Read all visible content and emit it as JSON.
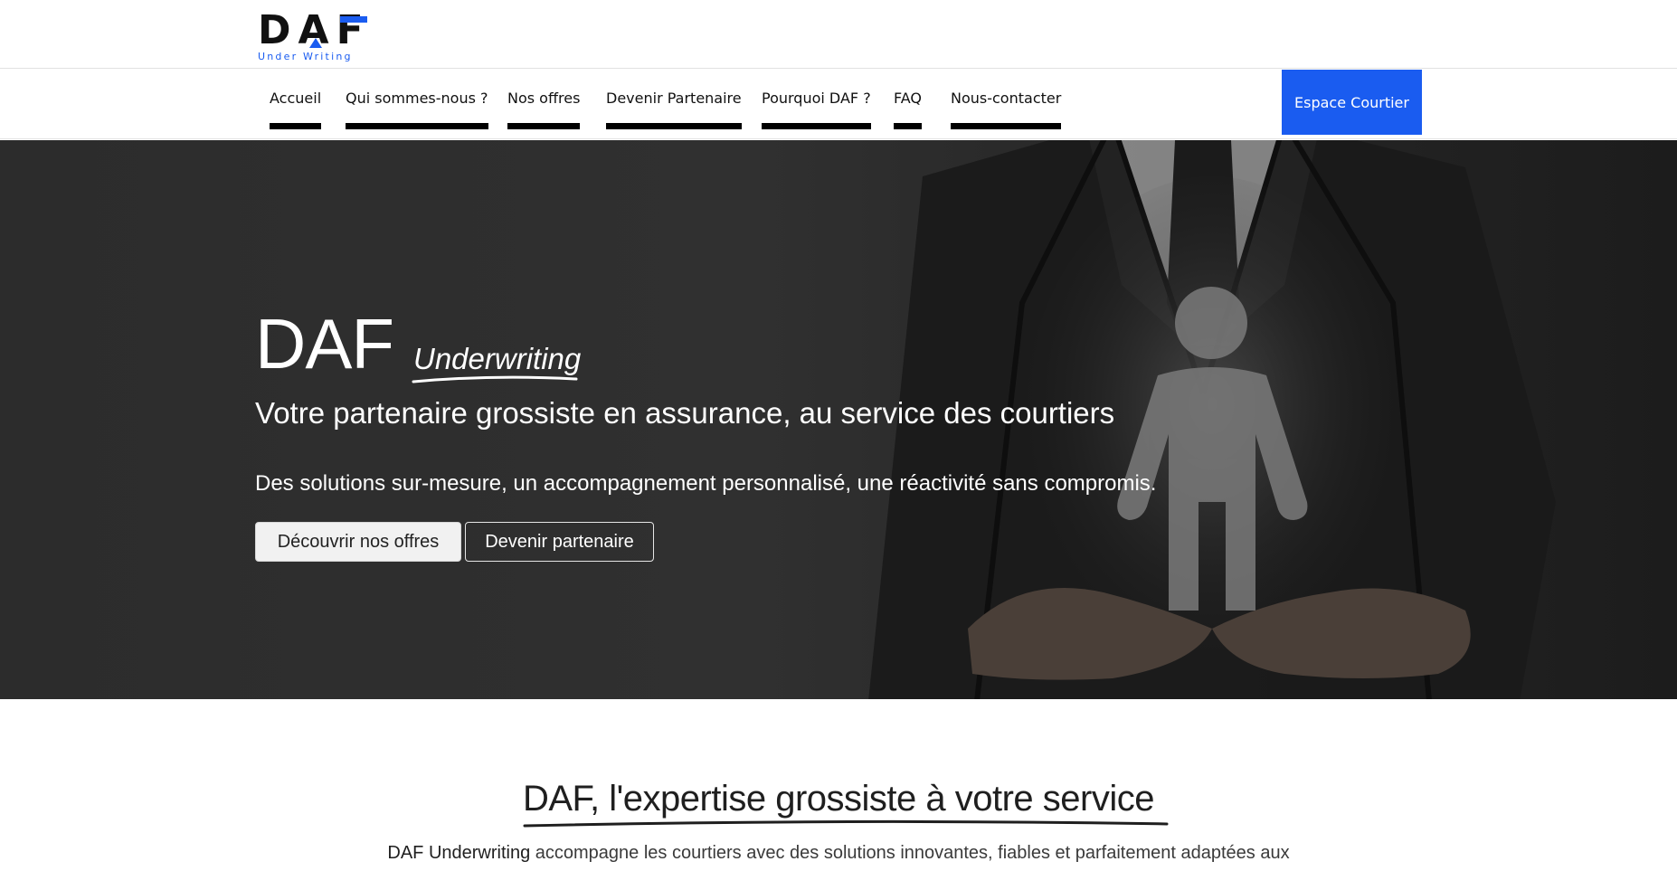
{
  "logo": {
    "mark": "DAF",
    "sub": "Under Writing"
  },
  "nav": {
    "items": [
      {
        "label": "Accueil"
      },
      {
        "label": "Qui sommes-nous ?"
      },
      {
        "label": "Nos offres"
      },
      {
        "label": "Devenir Partenaire"
      },
      {
        "label": "Pourquoi DAF ?"
      },
      {
        "label": "FAQ"
      },
      {
        "label": "Nous-contacter"
      }
    ],
    "broker_button": "Espace Courtier"
  },
  "hero": {
    "title": "DAF",
    "title_script": "Underwriting",
    "tagline": "Votre partenaire grossiste en assurance, au service des courtiers",
    "description": "Des solutions sur-mesure, un accompagnement personnalisé, une réactivité sans compromis.",
    "primary_button": "Découvrir nos offres",
    "secondary_button": "Devenir partenaire"
  },
  "section": {
    "title": "DAF, l'expertise grossiste à votre service",
    "intro_brand": "DAF Underwriting",
    "intro_rest": " accompagne les courtiers avec des solutions innovantes, fiables et parfaitement adaptées aux"
  },
  "colors": {
    "accent": "#1a5cf0",
    "hero_bg": "#2c2c2c",
    "nav_underline": "#000000"
  }
}
